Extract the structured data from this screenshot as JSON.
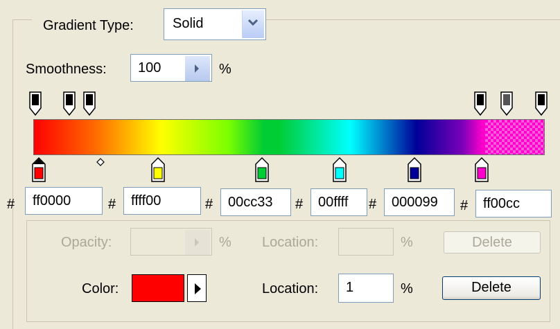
{
  "gradient_type": {
    "label": "Gradient Type:",
    "value": "Solid"
  },
  "smoothness": {
    "label": "Smoothness:",
    "value": "100",
    "unit": "%"
  },
  "opacity_stops": [
    {
      "color": "#000000"
    },
    {
      "color": "#000000"
    },
    {
      "color": "#000000"
    },
    {
      "color": "#000000"
    },
    {
      "color": "#555555"
    },
    {
      "color": "#000000"
    }
  ],
  "color_stops": [
    {
      "color": "#ff0000",
      "hex": "ff0000",
      "selected": true
    },
    {
      "color": "#ffff00",
      "hex": "ffff00"
    },
    {
      "color": "#00cc33",
      "hex": "00cc33"
    },
    {
      "color": "#00ffff",
      "hex": "00ffff"
    },
    {
      "color": "#000099",
      "hex": "000099"
    },
    {
      "color": "#ff00cc",
      "hex": "ff00cc"
    }
  ],
  "hash": "#",
  "opacity_row": {
    "opacity_label": "Opacity:",
    "opacity_value": "",
    "opacity_unit": "%",
    "location_label": "Location:",
    "location_value": "",
    "location_unit": "%",
    "delete_label": "Delete"
  },
  "color_row": {
    "color_label": "Color:",
    "color_value": "#ff0000",
    "location_label": "Location:",
    "location_value": "1",
    "location_unit": "%",
    "delete_label": "Delete"
  }
}
